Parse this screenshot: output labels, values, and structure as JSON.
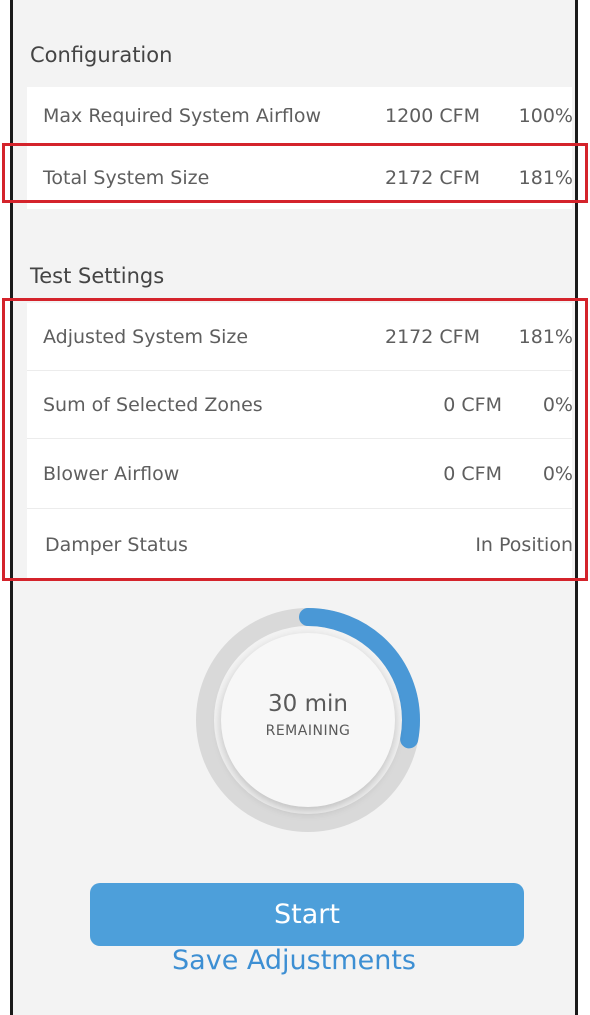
{
  "configuration": {
    "header": "Configuration",
    "rows": [
      {
        "label": "Max Required System Airflow",
        "cfm": "1200 CFM",
        "pct": "100%"
      },
      {
        "label": "Total System Size",
        "cfm": "2172 CFM",
        "pct": "181%"
      }
    ]
  },
  "test_settings": {
    "header": "Test Settings",
    "rows": [
      {
        "label": "Adjusted System Size",
        "cfm": "2172 CFM",
        "pct": "181%"
      },
      {
        "label": "Sum of Selected Zones",
        "cfm": "0 CFM",
        "pct": "0%"
      },
      {
        "label": "Blower Airflow",
        "cfm": "0 CFM",
        "pct": "0%"
      },
      {
        "label": "Damper Status",
        "value": "In Position"
      }
    ]
  },
  "timer": {
    "value": "30 min",
    "label": "REMAINING",
    "progress_fraction": 0.28,
    "progress_color": "#4a98d6",
    "track_color": "#d9d9d9"
  },
  "actions": {
    "start_label": "Start",
    "save_label": "Save Adjustments"
  },
  "colors": {
    "accent": "#4d9fda",
    "highlight": "#d4232b"
  }
}
